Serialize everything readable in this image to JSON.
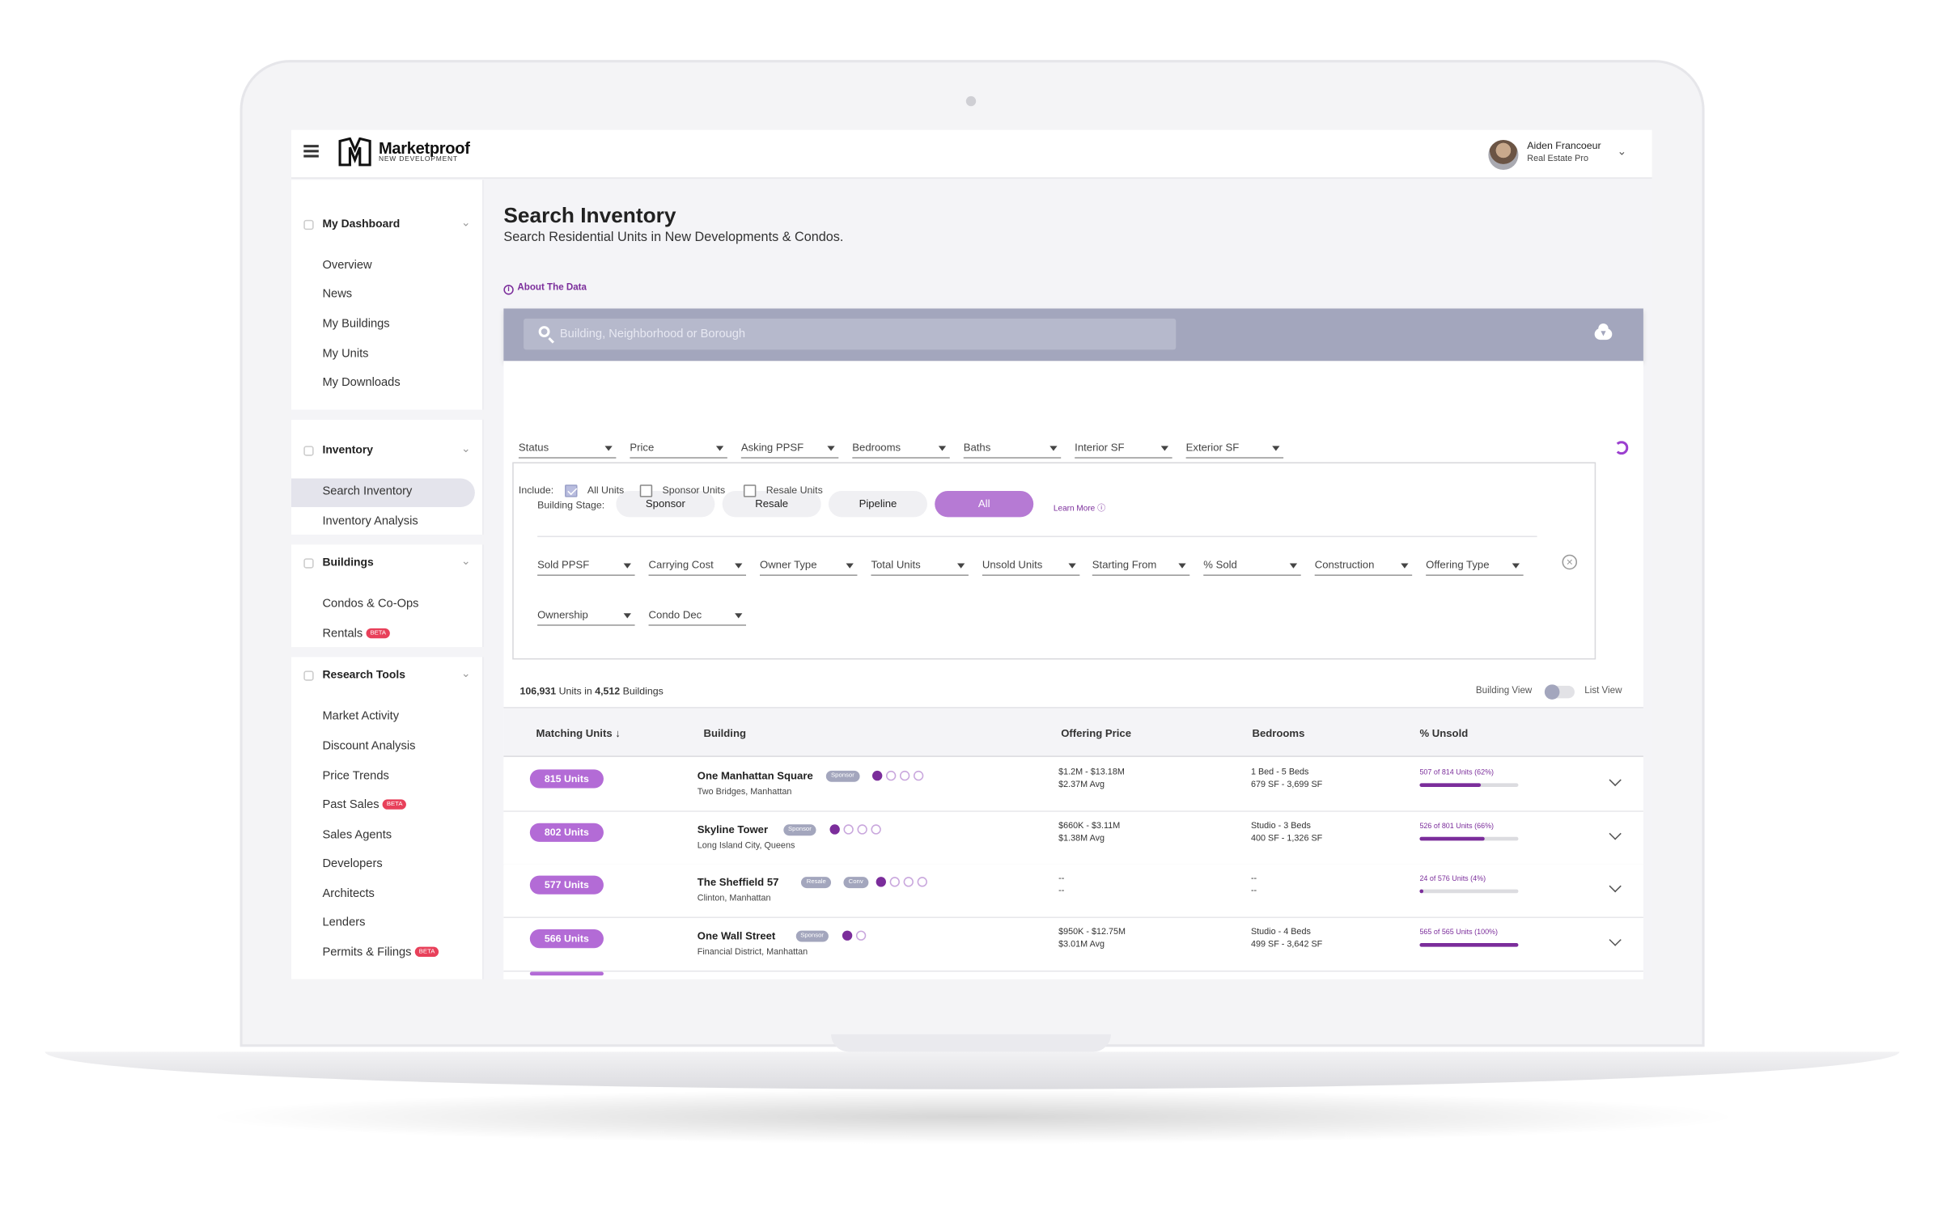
{
  "app": {
    "logo_name": "Marketproof",
    "logo_sub": "NEW DEVELOPMENT"
  },
  "user": {
    "name": "Aiden Francoeur",
    "role": "Real Estate Pro"
  },
  "sidebar": {
    "sections": [
      {
        "title": "My Dashboard",
        "items": [
          "Overview",
          "News",
          "My Buildings",
          "My Units",
          "My Downloads"
        ]
      },
      {
        "title": "Inventory",
        "items": [
          "Search Inventory",
          "Inventory Analysis"
        ]
      },
      {
        "title": "Buildings",
        "items": [
          "Condos & Co-Ops",
          "Rentals"
        ]
      },
      {
        "title": "Research Tools",
        "items": [
          "Market Activity",
          "Discount Analysis",
          "Price Trends",
          "Past Sales",
          "Sales Agents",
          "Developers",
          "Architects",
          "Lenders",
          "Permits & Filings"
        ]
      }
    ],
    "active_item": "Search Inventory",
    "beta_label": "BETA"
  },
  "page": {
    "title": "Search Inventory",
    "subtitle": "Search Residential Units in New Developments & Condos.",
    "about_link": "About The Data"
  },
  "search": {
    "placeholder": "Building, Neighborhood or Borough"
  },
  "filters": {
    "primary": [
      "Status",
      "Price",
      "Asking PPSF",
      "Bedrooms",
      "Baths",
      "Interior SF",
      "Exterior SF"
    ],
    "include_label": "Include:",
    "include_options": [
      {
        "label": "All Units",
        "checked": true
      },
      {
        "label": "Sponsor Units",
        "checked": false
      },
      {
        "label": "Resale Units",
        "checked": false
      }
    ],
    "stage_label": "Building Stage:",
    "stages": [
      "Sponsor",
      "Resale",
      "Pipeline",
      "All"
    ],
    "active_stage": "All",
    "learn_more": "Learn More",
    "advanced_row1": [
      "Sold PPSF",
      "Carrying Cost",
      "Owner Type",
      "Total Units",
      "Unsold Units",
      "Starting From",
      "% Sold",
      "Construction",
      "Offering Type"
    ],
    "advanced_row2": [
      "Ownership",
      "Condo Dec"
    ]
  },
  "results": {
    "units_count": "106,931",
    "units_text": "Units in",
    "buildings_count": "4,512",
    "buildings_text": "Buildings",
    "building_view": "Building View",
    "list_view": "List View"
  },
  "table": {
    "headers": {
      "matching": "Matching Units",
      "building": "Building",
      "price": "Offering Price",
      "bedrooms": "Bedrooms",
      "unsold": "% Unsold"
    },
    "rows": [
      {
        "units": "815 Units",
        "name": "One Manhattan Square",
        "tags": [
          "Sponsor"
        ],
        "location": "Two Bridges, Manhattan",
        "price_range": "$1.2M - $13.18M",
        "price_avg": "$2.37M Avg",
        "beds": "1 Bed - 5 Beds",
        "sf": "679 SF - 3,699 SF",
        "unsold_label": "507 of 814 Units (62%)",
        "unsold_pct": 62
      },
      {
        "units": "802 Units",
        "name": "Skyline Tower",
        "tags": [
          "Sponsor"
        ],
        "location": "Long Island City, Queens",
        "price_range": "$660K - $3.11M",
        "price_avg": "$1.38M Avg",
        "beds": "Studio - 3 Beds",
        "sf": "400 SF - 1,326 SF",
        "unsold_label": "526 of 801 Units (66%)",
        "unsold_pct": 66
      },
      {
        "units": "577 Units",
        "name": "The Sheffield 57",
        "tags": [
          "Resale",
          "Conv"
        ],
        "location": "Clinton, Manhattan",
        "price_range": "--",
        "price_avg": "--",
        "beds": "--",
        "sf": "--",
        "unsold_label": "24 of 576 Units (4%)",
        "unsold_pct": 4
      },
      {
        "units": "566 Units",
        "name": "One Wall Street",
        "tags": [
          "Sponsor"
        ],
        "location": "Financial District, Manhattan",
        "price_range": "$950K - $12.75M",
        "price_avg": "$3.01M Avg",
        "beds": "Studio - 4 Beds",
        "sf": "499 SF - 3,642 SF",
        "unsold_label": "565 of 565 Units (100%)",
        "unsold_pct": 100
      }
    ]
  }
}
